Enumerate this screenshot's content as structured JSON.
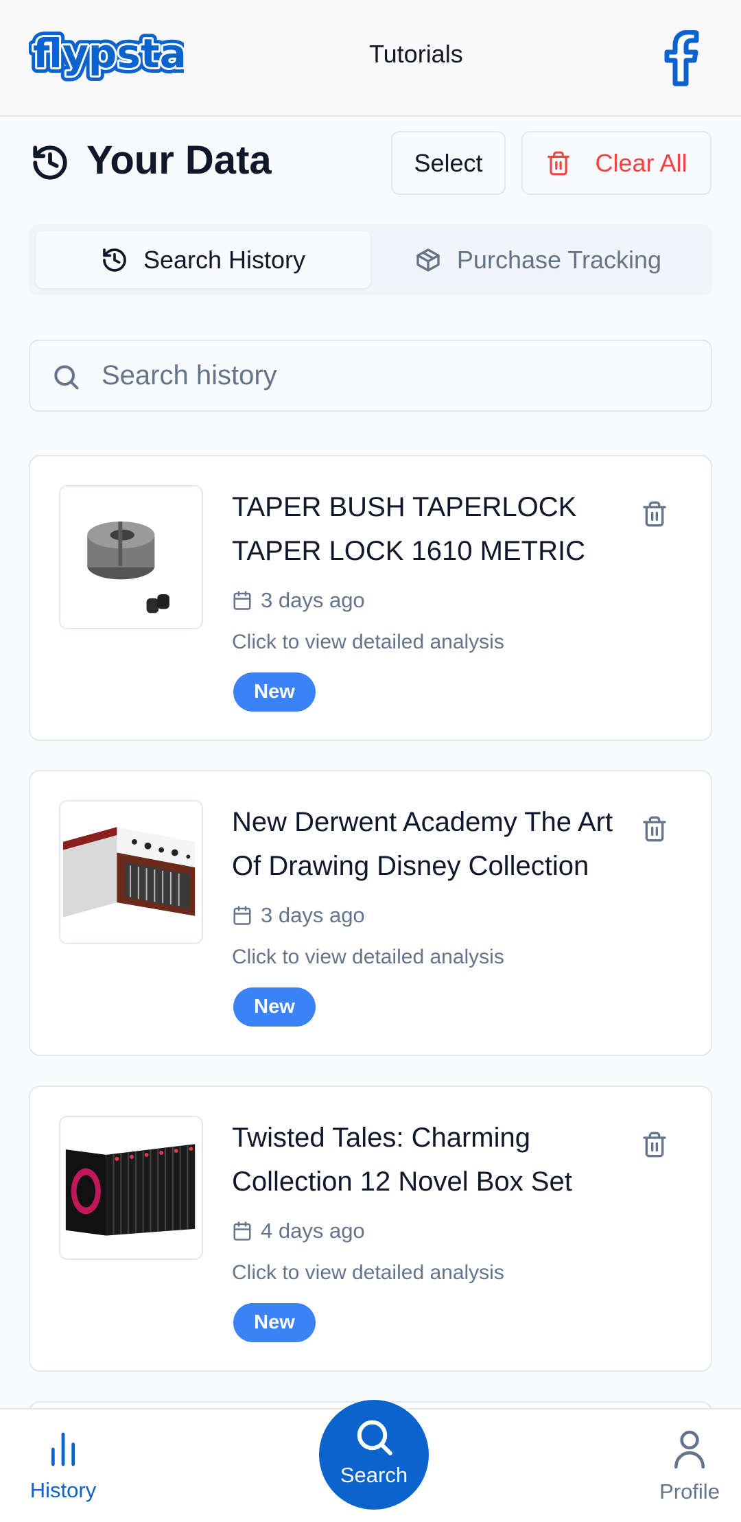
{
  "header": {
    "logo_text": "flypsta",
    "nav_link": "Tutorials",
    "right_icon": "facebook-icon"
  },
  "title_bar": {
    "title": "Your Data",
    "title_icon": "history-icon",
    "select_label": "Select",
    "clear_all_label": "Clear All"
  },
  "tabs": [
    {
      "label": "Search History",
      "icon": "history-icon",
      "active": true
    },
    {
      "label": "Purchase Tracking",
      "icon": "package-icon",
      "active": false
    }
  ],
  "search": {
    "placeholder": "Search history",
    "value": ""
  },
  "items": [
    {
      "title": "TAPER BUSH TAPERLOCK TAPER LOCK 1610 METRIC",
      "date": "3 days ago",
      "hint": "Click to view detailed analysis",
      "badge": "New"
    },
    {
      "title": "New Derwent Academy The Art Of Drawing Disney Collection",
      "date": "3 days ago",
      "hint": "Click to view detailed analysis",
      "badge": "New"
    },
    {
      "title": "Twisted Tales: Charming Collection 12 Novel Box Set",
      "date": "4 days ago",
      "hint": "Click to view detailed analysis",
      "badge": "New"
    }
  ],
  "bottom_nav": {
    "history_label": "History",
    "search_label": "Search",
    "profile_label": "Profile"
  },
  "colors": {
    "brand_blue": "#0b63ce",
    "badge_blue": "#3b82f6",
    "danger_red": "#ef4444",
    "muted_text": "#64748b"
  }
}
